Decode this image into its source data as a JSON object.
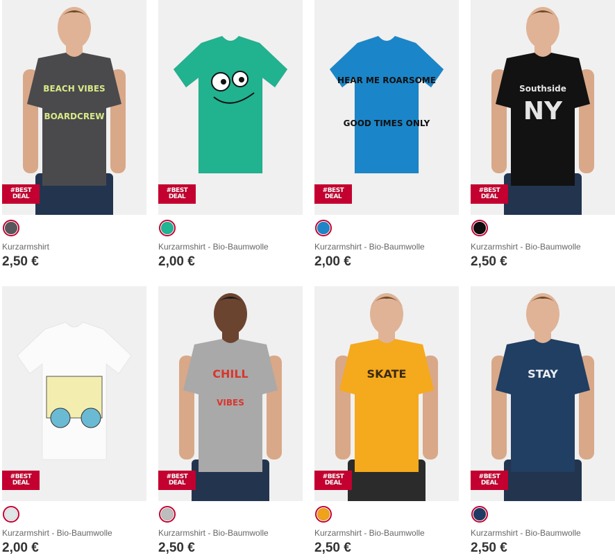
{
  "badge_text": "#BEST DEAL",
  "products": [
    {
      "name": "Kurzarmshirt",
      "price": "2,50 €",
      "swatch": "#58585c",
      "shirt": "#4a4a4d",
      "print": "BEACH VIBES",
      "print2": "BOARDCREW",
      "print_color": "#d8e986",
      "model": true
    },
    {
      "name": "Kurzarmshirt - Bio-Baumwolle",
      "price": "2,00 €",
      "swatch": "#1fb595",
      "shirt": "#21b28f",
      "print": "",
      "print2": "",
      "print_color": "#1b1b1b",
      "model": false,
      "face": true
    },
    {
      "name": "Kurzarmshirt - Bio-Baumwolle",
      "price": "2,00 €",
      "swatch": "#1e86c8",
      "shirt": "#1a86c9",
      "print": "HEAR ME ROARSOME",
      "print2": "GOOD TIMES ONLY",
      "print_color": "#111",
      "model": false
    },
    {
      "name": "Kurzarmshirt - Bio-Baumwolle",
      "price": "2,50 €",
      "swatch": "#0d0d0d",
      "shirt": "#121212",
      "print": "Southside",
      "print2": "NY",
      "print_color": "#e5e5e5",
      "model": true
    },
    {
      "name": "Kurzarmshirt - Bio-Baumwolle",
      "price": "2,00 €",
      "swatch": "#dfe6e8",
      "shirt": "#fbfbfb",
      "print": "",
      "print2": "",
      "print_color": "#4aa6c8",
      "model": false,
      "truck": true
    },
    {
      "name": "Kurzarmshirt - Bio-Baumwolle",
      "price": "2,50 €",
      "swatch": "#bdbdbd",
      "shirt": "#a9a9a9",
      "print": "CHILL",
      "print2": "VIBES",
      "print_color": "#d9352c",
      "model": true
    },
    {
      "name": "Kurzarmshirt - Bio-Baumwolle",
      "price": "2,50 €",
      "swatch": "#f0a31a",
      "shirt": "#f5a91c",
      "print": "SKATE",
      "print2": "",
      "print_color": "#3a2a14",
      "model": true
    },
    {
      "name": "Kurzarmshirt - Bio-Baumwolle",
      "price": "2,50 €",
      "swatch": "#203b63",
      "shirt": "#213e63",
      "print": "STAY",
      "print2": "",
      "print_color": "#e9eef3",
      "model": true
    }
  ]
}
